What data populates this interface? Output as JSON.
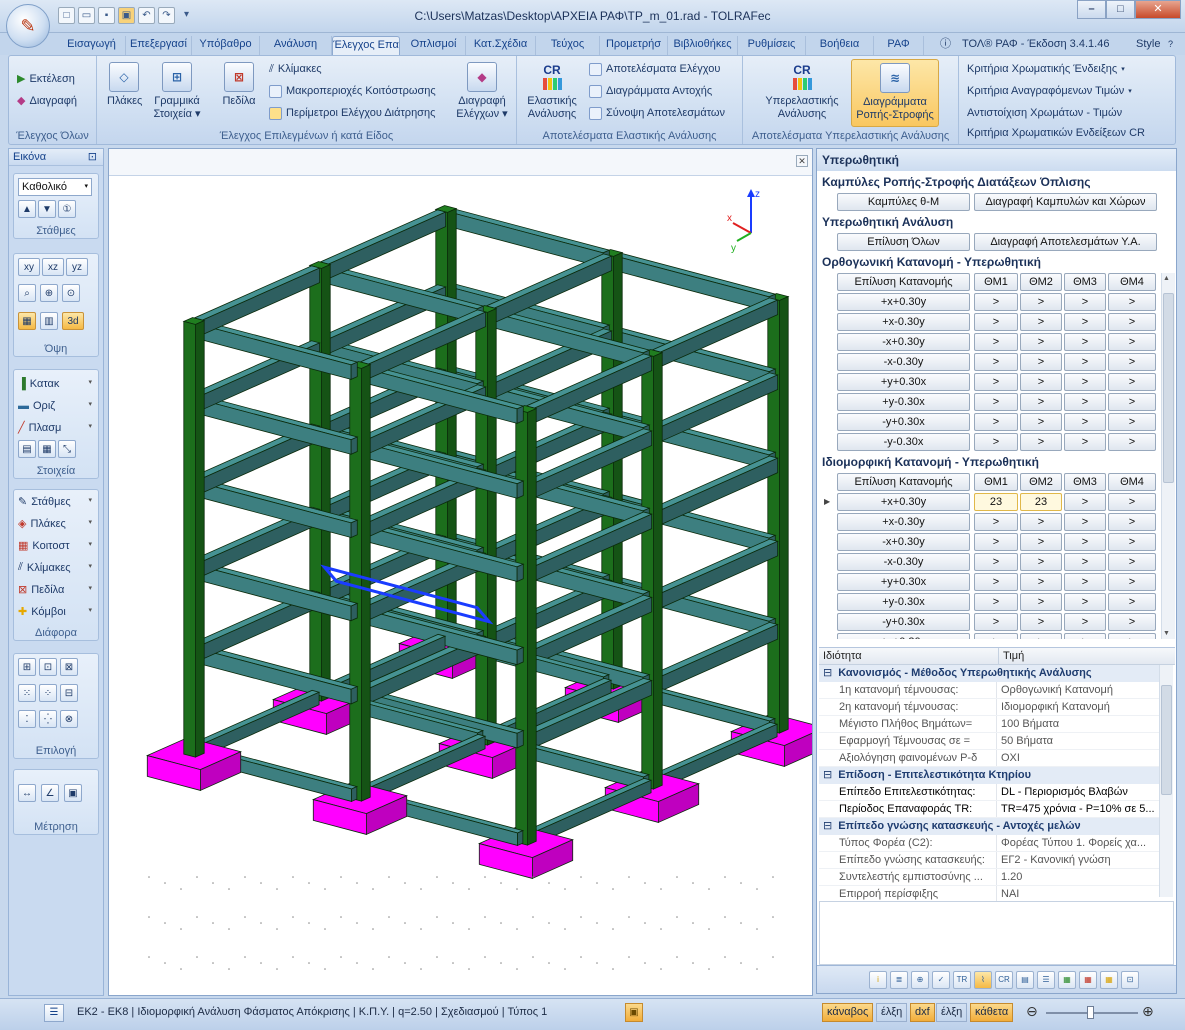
{
  "window": {
    "title": "C:\\Users\\Matzas\\Desktop\\ΑΡΧΕΙΑ ΡΑΦ\\TP_m_01.rad - TOLRAFec",
    "minimize": "–",
    "maximize": "□",
    "close": "✕"
  },
  "tabs": [
    "Εισαγωγή",
    "Επεξεργασία",
    "Υπόβαθρο",
    "Ανάλυση",
    "Έλεγχος Επάρκειας",
    "Οπλισμοί",
    "Κατ.Σχέδια",
    "Τεύχος",
    "Προμετρήσεις",
    "Βιβλιοθήκες",
    "Ρυθμίσεις",
    "Βοήθεια",
    "ΡΑΦ"
  ],
  "tab_labels": [
    "Εισαγωγή",
    "Επεξεργασί",
    "Υπόβαθρο",
    "Ανάλυση",
    "Έλεγχος Επα",
    "Οπλισμοί",
    "Κατ.Σχέδια",
    "Τεύχος",
    "Προμετρήσ",
    "Βιβλιοθήκες",
    "Ρυθμίσεις",
    "Βοήθεια",
    "ΡΑΦ"
  ],
  "active_tab": "Έλεγχος Επα",
  "version": "ΤΟΛ® ΡΑΦ - Έκδοση 3.4.1.46",
  "style_label": "Style",
  "ribbon": {
    "g1": {
      "label": "Έλεγχος Όλων",
      "run": "Εκτέλεση",
      "delete": "Διαγραφή"
    },
    "g2": {
      "label": "Έλεγχος Επιλεγμένων ή κατά Είδος",
      "slabs": "Πλάκες",
      "linear": "Γραμμικά Στοιχεία",
      "fields": "Πεδίλα",
      "stairs": "Κλίμακες",
      "macro": "Μακροπεριοχές Κοιτόστρωσης",
      "perim": "Περίμετροι Ελέγχου Διάτρησης",
      "del_checks": "Διαγραφή Ελέγχων"
    },
    "g3": {
      "label": "Αποτελέσματα Ελαστικής Ανάλυσης",
      "elastic": "Ελαστικής Ανάλυσης",
      "results": "Αποτελέσματα Ελέγχου",
      "strength": "Διαγράμματα Αντοχής",
      "summary": "Σύνοψη Αποτελεσμάτων"
    },
    "g4": {
      "label": "Αποτελέσματα Υπερελαστικής Ανάλυσης",
      "inelastic": "Υπερελαστικής Ανάλυσης",
      "moment": "Διαγράμματα Ροπής-Στροφής"
    },
    "g5": {
      "c1": "Κριτήρια Χρωματικής Ένδειξης",
      "c2": "Κριτήρια Αναγραφόμενων Τιμών",
      "c3": "Αντιστοίχιση Χρωμάτων - Τιμών",
      "c4": "Κριτήρια Χρωματικών Ενδείξεων CR"
    }
  },
  "left": {
    "title": "Εικόνα",
    "pin": "⊡",
    "combo": "Καθολικό",
    "g_stations": "Στάθμες",
    "views": [
      "xy",
      "xz",
      "yz"
    ],
    "view3d": "3d",
    "g_view": "Όψη",
    "el_vert": "Κατακ",
    "el_horiz": "Οριζ",
    "el_plasm": "Πλασμ",
    "g_elements": "Στοιχεία",
    "misc": [
      "Στάθμες",
      "Πλάκες",
      "Κοιτοστ",
      "Κλίμακες",
      "Πεδίλα",
      "Κόμβοι"
    ],
    "g_misc": "Διάφορα",
    "g_select": "Επιλογή",
    "g_measure": "Μέτρηση"
  },
  "axes": {
    "x": "x",
    "y": "y",
    "z": "z"
  },
  "right": {
    "title": "Υπερωθητική",
    "sec_curves": "Καμπύλες Ροπής-Στροφής Διατάξεων Όπλισης",
    "btn_curves": "Καμπύλες θ-Μ",
    "btn_del_curves": "Διαγραφή Καμπυλών και Χώρων",
    "sec_analysis": "Υπερωθητική Ανάλυση",
    "btn_solve_all": "Επίλυση Όλων",
    "btn_del_results": "Διαγραφή Αποτελεσμάτων Υ.Α.",
    "sec_orth": "Ορθογωνική Κατανομή - Υπερωθητική",
    "sec_idio": "Ιδιομορφική Κατανομή - Υπερωθητική",
    "col_solve": "Επίλυση Κατανομής",
    "cols": [
      "ΘΜ1",
      "ΘΜ2",
      "ΘΜ3",
      "ΘΜ4"
    ],
    "rows": [
      "+x+0.30y",
      "+x-0.30y",
      "-x+0.30y",
      "-x-0.30y",
      "+y+0.30x",
      "+y-0.30x",
      "-y+0.30x",
      "-y-0.30x"
    ],
    "cell": ">",
    "idio_first": [
      "23",
      "23"
    ],
    "partial_row": "+x+0.30y",
    "props_header": {
      "name": "Ιδιότητα",
      "value": "Τιμή"
    },
    "props": [
      {
        "cat": "Κανονισμός - Μέθοδος Υπερωθητικής Ανάλυσης"
      },
      {
        "k": "1η κατανομή τέμνουσας:",
        "v": "Ορθογωνική Κατανομή"
      },
      {
        "k": "2η κατανομή τέμνουσας:",
        "v": "Ιδιομορφική Κατανομή"
      },
      {
        "k": "Μέγιστο Πλήθος Βημάτων=",
        "v": "100 Βήματα"
      },
      {
        "k": "Εφαρμογή Τέμνουσας σε =",
        "v": "50 Βήματα"
      },
      {
        "k": "Αξιολόγηση φαινομένων Ρ-δ",
        "v": "ΟΧΙ"
      },
      {
        "cat": "Επίδοση - Επιτελεστικότητα Κτηρίου"
      },
      {
        "k": "Επίπεδο Επιτελεστικότητας:",
        "v": "DL - Περιορισμός Βλαβών",
        "b": true
      },
      {
        "k": "Περίοδος Επαναφοράς TR:",
        "v": "TR=475 χρόνια - P=10% σε 5...",
        "b": true
      },
      {
        "cat": "Επίπεδο γνώσης κατασκευής - Αντοχές μελών"
      },
      {
        "k": "Τύπος Φορέα (C2):",
        "v": "Φορέας Τύπου 1. Φορείς χα..."
      },
      {
        "k": "Επίπεδο γνώσης κατασκευής:",
        "v": "ΕΓ2 - Κανονική γνώση"
      },
      {
        "k": "Συντελεστής εμπιστοσύνης ...",
        "v": "1.20"
      },
      {
        "k": "Επιρροή περίσφιξης",
        "v": "ΝΑΙ"
      }
    ]
  },
  "status": {
    "text": "ΕΚ2 - ΕΚ8 | Ιδιομορφική Ανάλυση Φάσματος Απόκρισης | Κ.Π.Υ. | q=2.50 | Σχεδιασμού | Τύπος 1",
    "b1": "κάναβος",
    "b2": "έλξη",
    "b3": "dxf",
    "b4": "έλξη",
    "b5": "κάθετα"
  },
  "colors": {
    "column": "#1c6e1c",
    "beam": "#3d7f80",
    "footing": "#ff00ff",
    "selected": "#1a3cff",
    "accent": "#f5b944"
  }
}
